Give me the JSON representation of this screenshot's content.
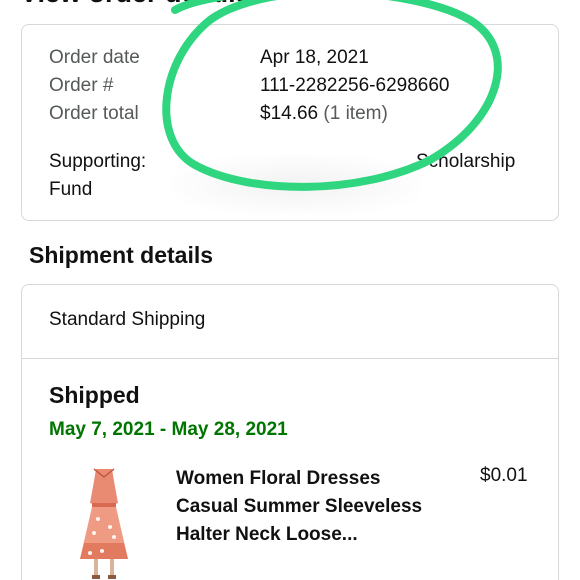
{
  "header": {
    "title": "View order details"
  },
  "order_summary": {
    "date_label": "Order date",
    "date_value": "Apr 18, 2021",
    "number_label": "Order #",
    "number_value": "111-2282256-6298660",
    "total_label": "Order total",
    "total_value": "$14.66",
    "total_count": "(1 item)",
    "supporting_label": "Supporting:",
    "supporting_label_2": "Fund",
    "supporting_value": "Scholarship"
  },
  "shipment": {
    "section_title": "Shipment details",
    "method": "Standard Shipping",
    "status": "Shipped",
    "delivery_range": "May 7, 2021 - May 28, 2021",
    "item": {
      "title": "Women Floral Dresses Casual Summer Sleeveless Halter Neck Loose...",
      "price": "$0.01"
    }
  },
  "colors": {
    "delivery_green": "#007600",
    "highlight_circle": "#2fd67f",
    "border": "#d5d9d9"
  }
}
